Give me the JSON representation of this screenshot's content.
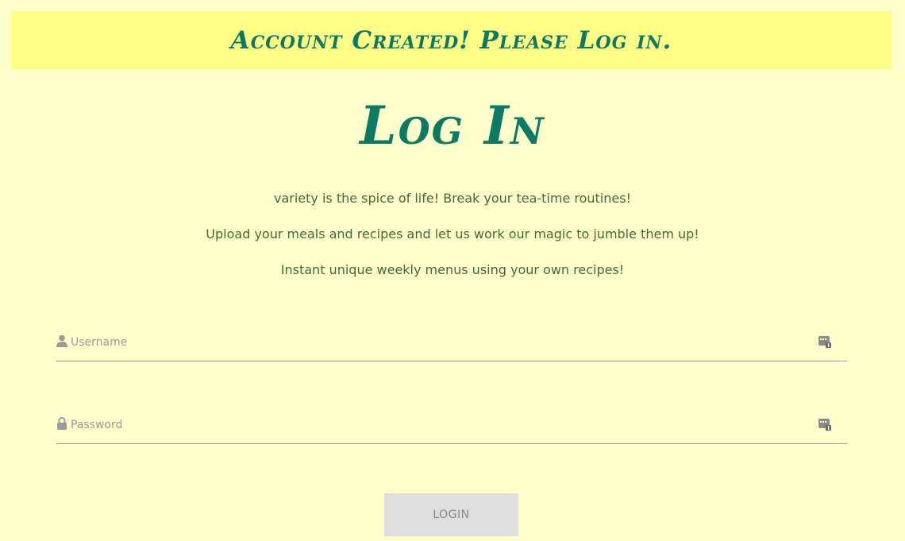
{
  "banner": {
    "message": "Account Created! Please Log in."
  },
  "page": {
    "title": "Log In"
  },
  "taglines": [
    "variety is the spice of life! Break your tea-time routines!",
    "Upload your meals and recipes and let us work our magic to jumble them up!",
    "Instant unique weekly menus using your own recipes!"
  ],
  "form": {
    "username": {
      "placeholder": "Username",
      "value": "",
      "icon": "user-icon"
    },
    "password": {
      "placeholder": "Password",
      "value": "",
      "icon": "lock-icon"
    },
    "submit_label": "LOGIN"
  },
  "colors": {
    "background": "#ffffcc",
    "banner": "#ffff88",
    "heading": "#0c7a62",
    "text": "#3f6b3c",
    "button": "#dedede"
  }
}
